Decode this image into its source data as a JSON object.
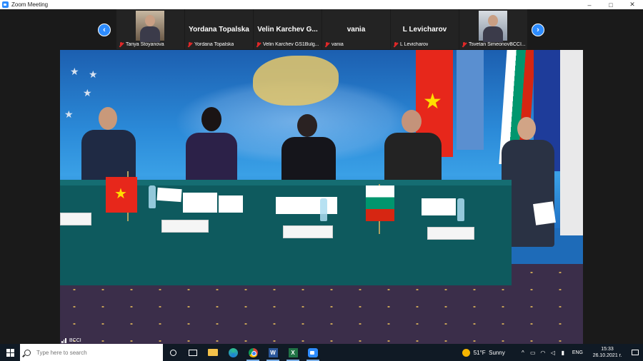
{
  "window": {
    "title": "Zoom Meeting",
    "controls": {
      "minimize": "–",
      "maximize": "□",
      "close": "✕"
    }
  },
  "strip": {
    "prev_icon": "chevron-left-icon",
    "next_icon": "chevron-right-icon",
    "participants": [
      {
        "big_name": "",
        "name": "Tanya Stoyanova",
        "muted": true,
        "has_video": true
      },
      {
        "big_name": "Yordana Topalska",
        "name": "Yordana Topalska",
        "muted": true,
        "has_video": false
      },
      {
        "big_name": "Velin Karchev G...",
        "name": "Velin Karchev GS1Bulg...",
        "muted": true,
        "has_video": false
      },
      {
        "big_name": "vania",
        "name": "vania",
        "muted": true,
        "has_video": false
      },
      {
        "big_name": "L Levicharov",
        "name": "L Levicharov",
        "muted": true,
        "has_video": false
      },
      {
        "big_name": "",
        "name": "Tsvetan SimeonovBCCI...",
        "muted": true,
        "has_video": true
      }
    ]
  },
  "main": {
    "speaker_name": "BCCI"
  },
  "taskbar": {
    "search_placeholder": "Type here to search",
    "apps": [
      "cortana-icon",
      "task-view-icon",
      "file-explorer-icon",
      "edge-icon",
      "chrome-icon",
      "word-icon",
      "excel-icon",
      "zoom-icon"
    ],
    "weather_temp": "51°F",
    "weather_desc": "Sunny",
    "language": "ENG",
    "time": "15:33",
    "date": "26.10.2021 г."
  },
  "colors": {
    "zoom_blue": "#2d8cff",
    "taskbar": "#101a25",
    "table_green": "#0e5a5e"
  }
}
